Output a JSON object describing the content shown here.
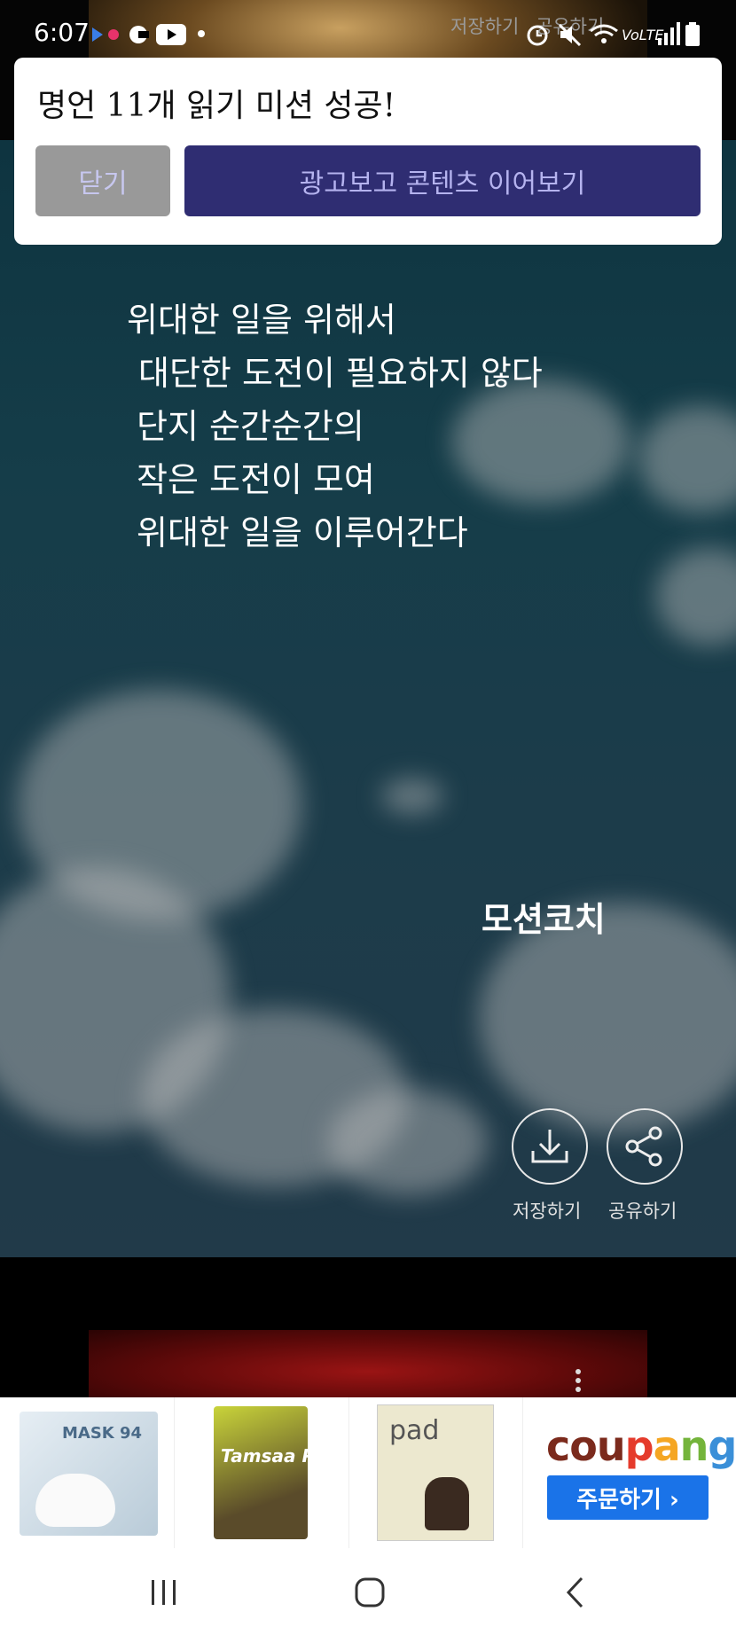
{
  "status_bar": {
    "time": "6:07"
  },
  "top_ghost": {
    "save": "저장하기",
    "share": "공유하기"
  },
  "dialog": {
    "message": "명언 11개 읽기 미션 성공!",
    "close_label": "닫기",
    "watch_ad_label": "광고보고 콘텐츠 이어보기"
  },
  "quote": {
    "lines": [
      "위대한 일을 위해서",
      "대단한 도전이 필요하지 않다",
      "단지 순간순간의",
      "작은 도전이 모여",
      "위대한 일을 이루어간다"
    ],
    "author": "모션코치"
  },
  "actions": {
    "save_label": "저장하기",
    "share_label": "공유하기"
  },
  "ad": {
    "brand": [
      "cou",
      "p",
      "a",
      "n",
      "g"
    ],
    "order_label": "주문하기 ›",
    "product_1_text": "MASK 94",
    "product_2_text": "Tamsaa Pure",
    "product_3_text": "pad"
  },
  "colors": {
    "accent": "#2f2d72",
    "close_button": "#999999",
    "coupang_blue": "#1a73e8"
  },
  "icons": [
    "download-icon",
    "share-icon",
    "alarm-icon",
    "mute-icon",
    "wifi-icon",
    "signal-icon",
    "battery-icon",
    "youtube-icon"
  ]
}
